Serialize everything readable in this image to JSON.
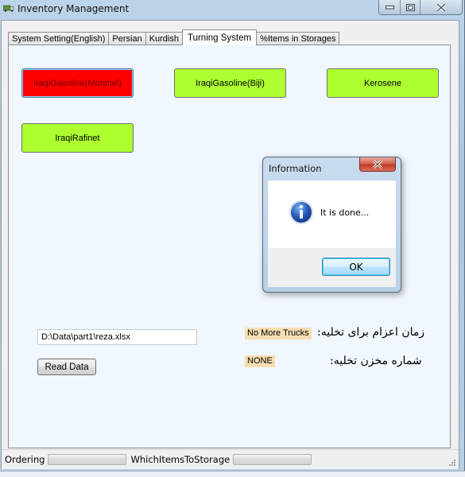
{
  "window": {
    "title": "Inventory Management",
    "app_icon": "truck-icon",
    "controls": [
      "minimize",
      "maximize",
      "close"
    ]
  },
  "tabs": [
    {
      "label": "System Setting(English)",
      "active": false
    },
    {
      "label": "Persian",
      "active": false
    },
    {
      "label": "Kurdish",
      "active": false
    },
    {
      "label": "Turning System",
      "active": true
    },
    {
      "label": "%Items in Storages",
      "active": false
    }
  ],
  "fuel_buttons": [
    {
      "label": "IraqiGasoline(Mohmel)",
      "color": "#ff0000",
      "state": "selected"
    },
    {
      "label": "IraqiGasoline(Biji)",
      "color": "#adff2f",
      "state": "normal"
    },
    {
      "label": "Kerosene",
      "color": "#adff2f",
      "state": "normal"
    },
    {
      "label": "IraqiRafinet",
      "color": "#adff2f",
      "state": "normal"
    }
  ],
  "file_input": {
    "value": "D:\\Data\\part1\\reza.xlsx"
  },
  "read_button": {
    "label": "Read Data"
  },
  "dispatch_time": {
    "label": "زمان اعزام برای تخلیه:",
    "value": "No More Trucks"
  },
  "storage_number": {
    "label": "شماره مخزن تخلیه:",
    "value": "NONE"
  },
  "statusbar": {
    "ordering_label": "Ordering",
    "ordering_progress": 0,
    "which_items_label": "WhichItemsToStorage",
    "which_items_progress": 0
  },
  "dialog": {
    "title": "Information",
    "icon": "info-icon",
    "message": "It is done...",
    "ok_label": "OK"
  },
  "colors": {
    "selected_button": "#ff0000",
    "fuel_button": "#adff2f",
    "status_tag": "#f5deb3",
    "panel_bg": "#f0f7fd"
  }
}
